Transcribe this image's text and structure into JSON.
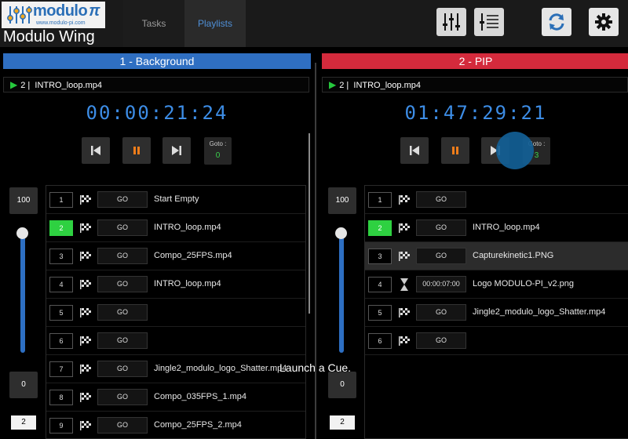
{
  "app": {
    "logo_word": "modulo",
    "logo_pi": "π",
    "logo_url": "www.modulo-pi.com",
    "title": "Modulo Wing"
  },
  "tabs": [
    {
      "label": "Tasks",
      "active": false
    },
    {
      "label": "Playlists",
      "active": true
    }
  ],
  "toolbar": {
    "icons": [
      "mixer-sliders-icon",
      "playlist-view-icon",
      "sync-icon",
      "gear-icon"
    ]
  },
  "panels": [
    {
      "header": "1 - Background",
      "header_color": "#2f6fc2",
      "now_playing": {
        "index": "2 |",
        "file": "INTRO_loop.mp4"
      },
      "timecode": "00:00:21:24",
      "goto": {
        "label": "Goto :",
        "value": "0"
      },
      "volume": {
        "max": "100",
        "min": "0",
        "level": 1.0
      },
      "page": "2",
      "cues": [
        {
          "num": "1",
          "active": false,
          "trigger": "flag-icon",
          "go": "GO",
          "name": "Start Empty"
        },
        {
          "num": "2",
          "active": true,
          "trigger": "flag-icon",
          "go": "GO",
          "name": "INTRO_loop.mp4"
        },
        {
          "num": "3",
          "active": false,
          "trigger": "flag-icon",
          "go": "GO",
          "name": "Compo_25FPS.mp4"
        },
        {
          "num": "4",
          "active": false,
          "trigger": "flag-icon",
          "go": "GO",
          "name": "INTRO_loop.mp4"
        },
        {
          "num": "5",
          "active": false,
          "trigger": "flag-icon",
          "go": "GO",
          "name": ""
        },
        {
          "num": "6",
          "active": false,
          "trigger": "flag-icon",
          "go": "GO",
          "name": ""
        },
        {
          "num": "7",
          "active": false,
          "trigger": "flag-icon",
          "go": "GO",
          "name": "Jingle2_modulo_logo_Shatter.mp4"
        },
        {
          "num": "8",
          "active": false,
          "trigger": "flag-icon",
          "go": "GO",
          "name": "Compo_035FPS_1.mp4"
        },
        {
          "num": "9",
          "active": false,
          "trigger": "flag-icon",
          "go": "GO",
          "name": "Compo_25FPS_2.mp4"
        }
      ]
    },
    {
      "header": "2 - PIP",
      "header_color": "#d42a3c",
      "now_playing": {
        "index": "2 |",
        "file": "INTRO_loop.mp4"
      },
      "timecode": "01:47:29:21",
      "goto": {
        "label": "Goto :",
        "value": "3"
      },
      "volume": {
        "max": "100",
        "min": "0",
        "level": 1.0
      },
      "page": "2",
      "cues": [
        {
          "num": "1",
          "active": false,
          "trigger": "flag-icon",
          "go": "GO",
          "name": ""
        },
        {
          "num": "2",
          "active": true,
          "trigger": "flag-icon",
          "go": "GO",
          "name": "INTRO_loop.mp4"
        },
        {
          "num": "3",
          "active": false,
          "highlight": true,
          "trigger": "flag-icon",
          "go": "GO",
          "name": "Capturekinetic1.PNG"
        },
        {
          "num": "4",
          "active": false,
          "trigger": "hourglass-icon",
          "go": "00:00:07:00",
          "name": "Logo MODULO-PI_v2.png"
        },
        {
          "num": "5",
          "active": false,
          "trigger": "flag-icon",
          "go": "GO",
          "name": "Jingle2_modulo_logo_Shatter.mp4"
        },
        {
          "num": "6",
          "active": false,
          "trigger": "flag-icon",
          "go": "GO",
          "name": ""
        }
      ]
    }
  ],
  "tooltip": "Launch a Cue."
}
